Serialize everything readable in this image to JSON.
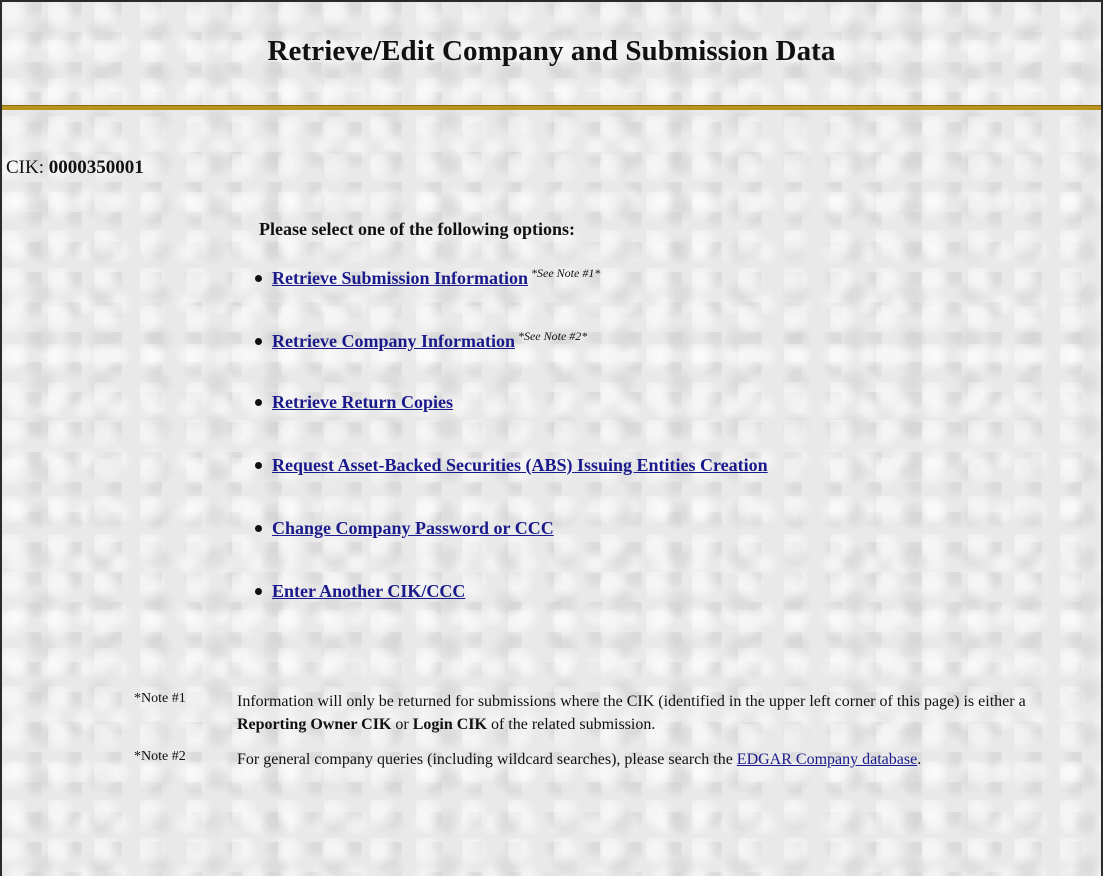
{
  "page": {
    "title": "Retrieve/Edit Company and Submission Data",
    "accent_color": "#b9941c",
    "link_color": "#1a1a8c"
  },
  "cik": {
    "label": "CIK:",
    "value": "0000350001"
  },
  "prompt": "Please select one of the following options:",
  "options": [
    {
      "label": "Retrieve Submission Information",
      "note": "*See Note #1*"
    },
    {
      "label": "Retrieve Company Information",
      "note": "*See Note #2*"
    },
    {
      "label": "Retrieve Return Copies"
    },
    {
      "label": "Request Asset-Backed Securities (ABS) Issuing Entities Creation"
    },
    {
      "label": "Change Company Password or CCC"
    },
    {
      "label": "Enter Another CIK/CCC"
    }
  ],
  "notes": [
    {
      "label": "*Note #1",
      "text_a": "Information will only be returned for submissions where the CIK (identified in the upper left corner of this page) is either a",
      "bold_a": "Reporting Owner CIK",
      "text_b": "or",
      "bold_b": "Login CIK",
      "text_c": "of the related submission."
    },
    {
      "label": "*Note #2",
      "text_a": "For general company queries (including wildcard searches), please search the",
      "link": "EDGAR Company database",
      "text_b": "."
    }
  ]
}
